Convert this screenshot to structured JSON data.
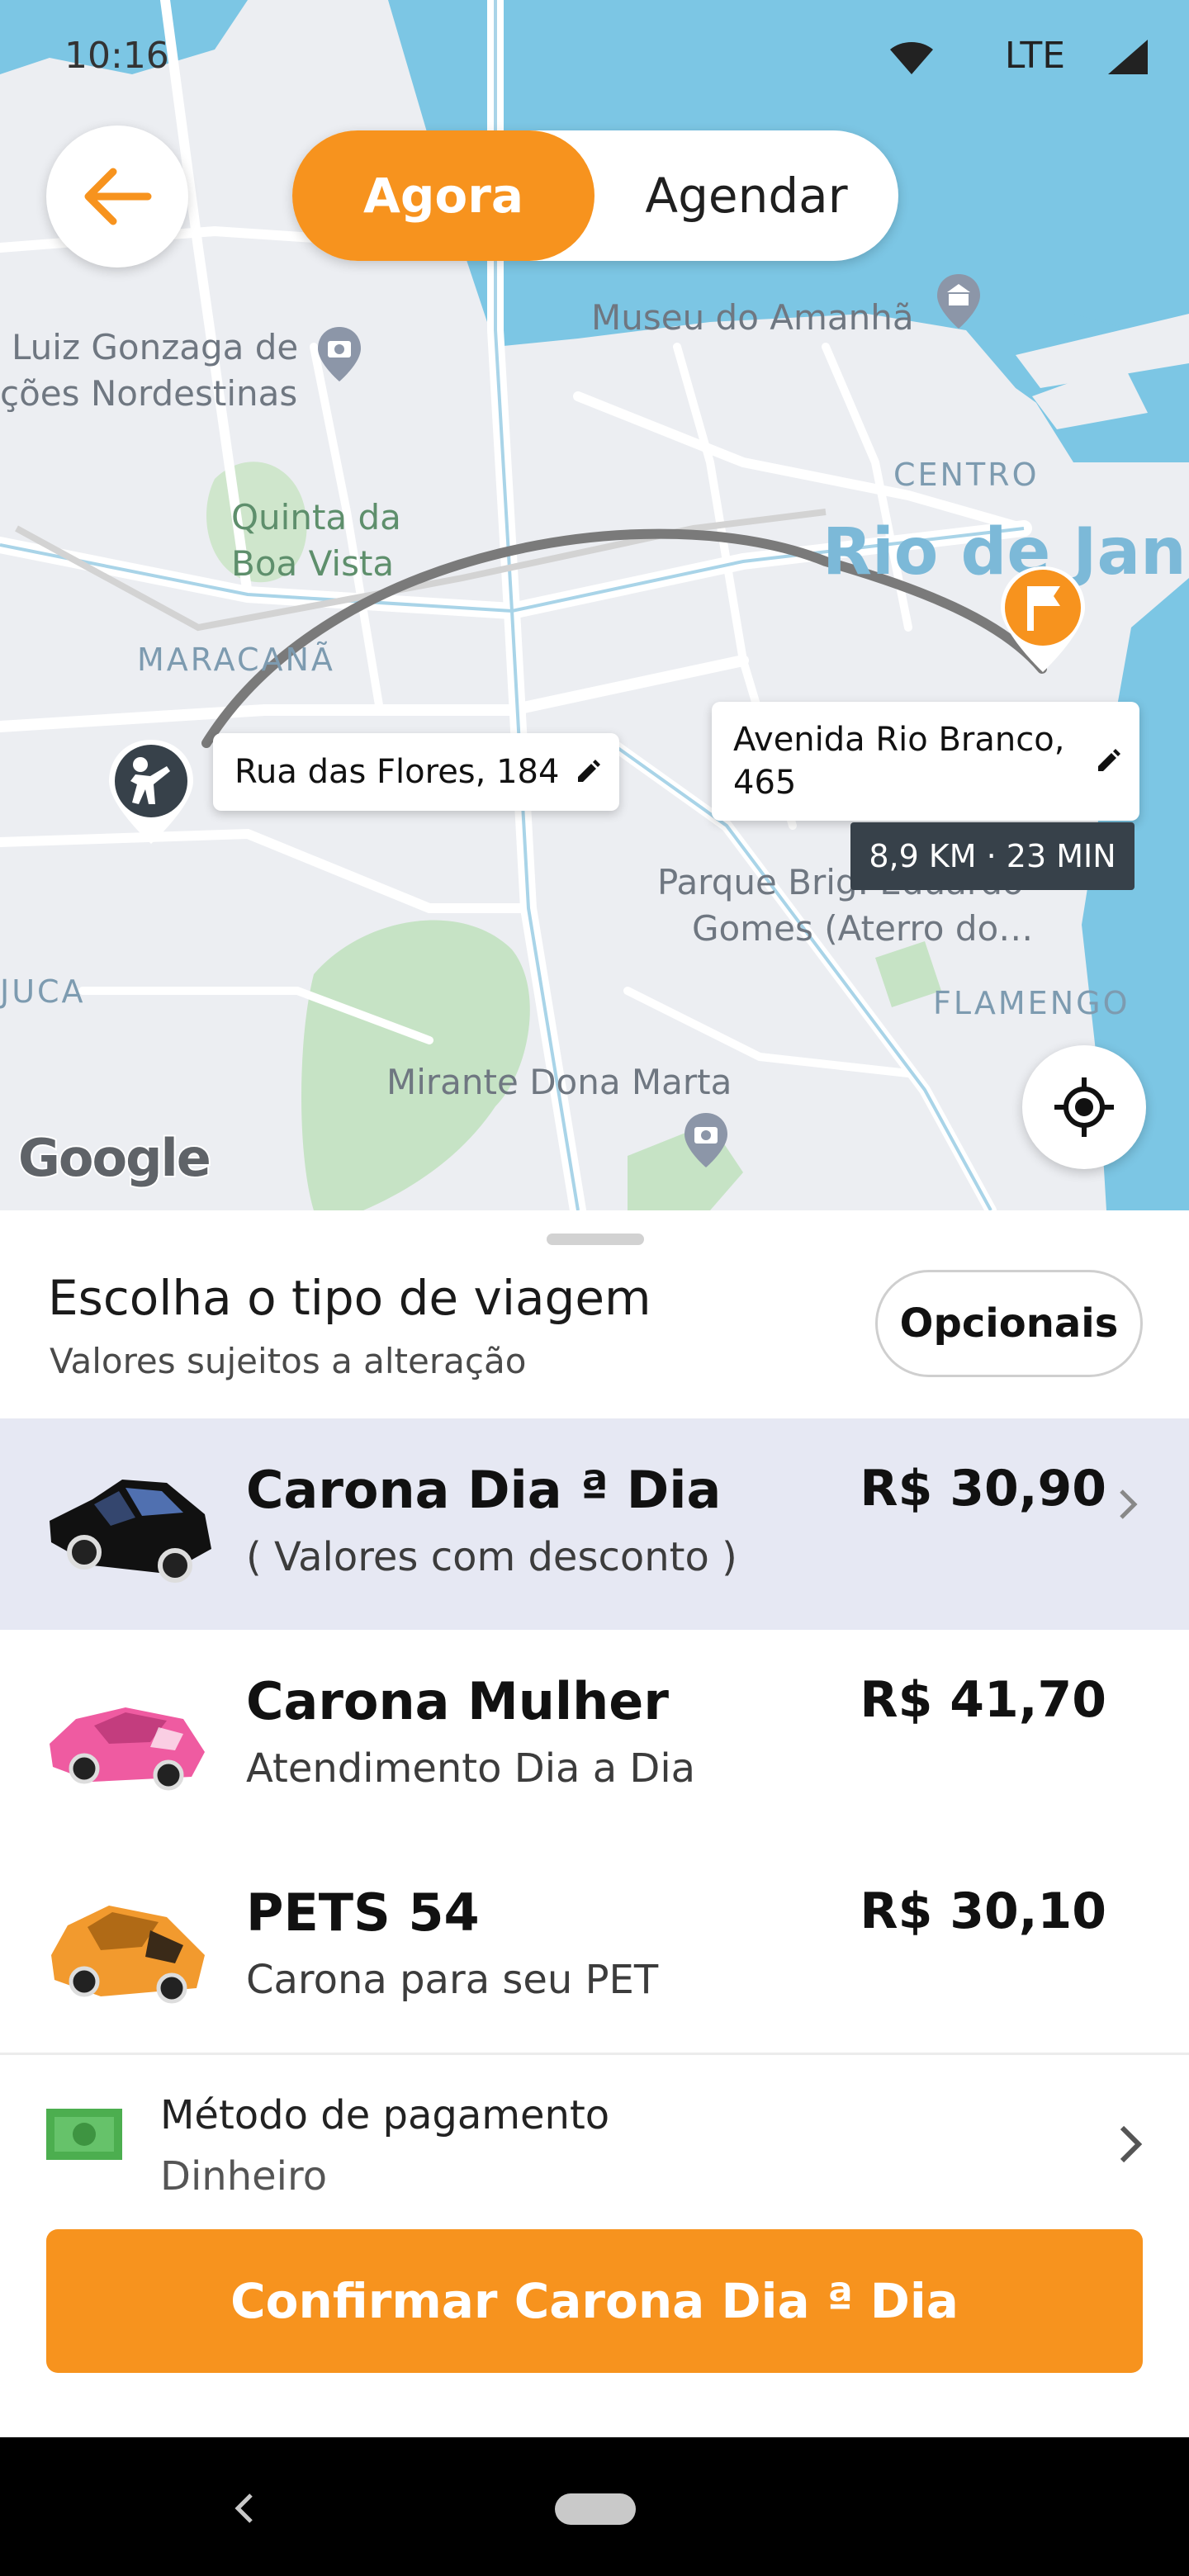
{
  "status_bar": {
    "time": "10:16",
    "network": "LTE"
  },
  "header": {
    "mode_now": "Agora",
    "mode_schedule": "Agendar"
  },
  "map": {
    "labels": {
      "museu": "Museu do Amanhã",
      "luiz_1": "Luiz Gonzaga de",
      "luiz_2": "ções Nordestinas",
      "quinta_1": "Quinta da",
      "quinta_2": "Boa Vista",
      "centro": "CENTRO",
      "rio": "Rio de Jane",
      "maracana": "MARACANÃ",
      "parque_1": "Parque Brig. Eduardo",
      "parque_2": "Gomes (Aterro do…",
      "juca": "JUCA",
      "flamengo": "FLAMENGO",
      "mirante": "Mirante Dona Marta",
      "google": "Google"
    },
    "origin_address": "Rua das Flores, 184",
    "destination_line1": "Avenida Rio Branco,",
    "destination_line2": "465",
    "route_info": "8,9 KM · 23 MIN"
  },
  "sheet": {
    "title": "Escolha o tipo de viagem",
    "subtitle": "Valores sujeitos a alteração",
    "options_button": "Opcionais",
    "rides": [
      {
        "name": "Carona Dia ª Dia",
        "desc": "( Valores com desconto )",
        "price": "R$ 30,90",
        "color": "#111111",
        "selected": true
      },
      {
        "name": "Carona Mulher",
        "desc": "Atendimento Dia a Dia",
        "price": "R$ 41,70",
        "color": "#ef5ba1",
        "selected": false
      },
      {
        "name": "PETS 54",
        "desc": "Carona para seu PET",
        "price": "R$ 30,10",
        "color": "#f29a2e",
        "selected": false
      }
    ],
    "payment": {
      "label": "Método de pagamento",
      "value": "Dinheiro"
    },
    "confirm_button": "Confirmar Carona Dia ª Dia"
  },
  "colors": {
    "accent": "#f7931e",
    "water": "#7cc6e4",
    "selected_row": "#e6e8f3"
  }
}
